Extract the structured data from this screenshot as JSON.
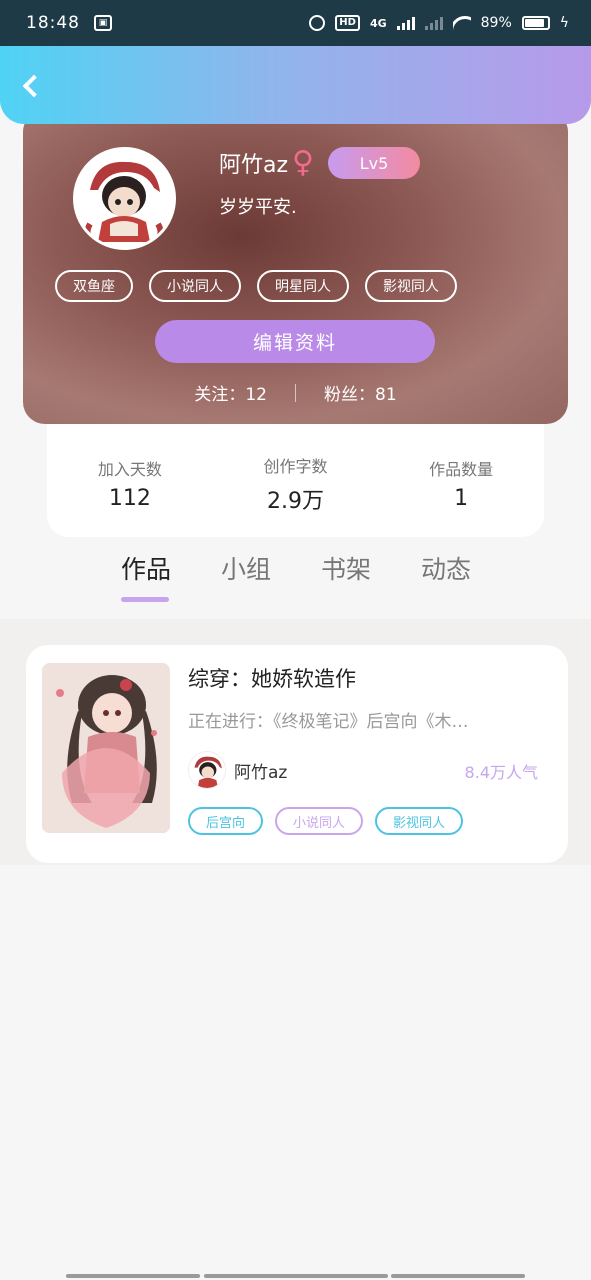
{
  "status_bar": {
    "time": "18:48",
    "hd_label": "HD",
    "network": "4G",
    "battery_text": "89%",
    "battery_level": 0.89,
    "icons": [
      "alarm-icon",
      "hd-icon",
      "signal-icon",
      "wifi-icon",
      "battery-icon",
      "charging-icon"
    ]
  },
  "header": {
    "back_icon": "back-arrow-icon",
    "gradient": [
      "#4fd3f4",
      "#b79aea"
    ]
  },
  "profile": {
    "username": "阿竹az",
    "gender_symbol": "♀",
    "level": "Lv5",
    "bio": "岁岁平安.",
    "tags": [
      "双鱼座",
      "小说同人",
      "明星同人",
      "影视同人"
    ],
    "edit_button": "编辑资料",
    "following": "关注：12",
    "followers": "粉丝：81"
  },
  "stats": [
    {
      "label": "加入天数",
      "value": "112"
    },
    {
      "label": "创作字数",
      "value": "2.9万"
    },
    {
      "label": "作品数量",
      "value": "1"
    }
  ],
  "tabs": [
    {
      "label": "作品",
      "active": true
    },
    {
      "label": "小组",
      "active": false
    },
    {
      "label": "书架",
      "active": false
    },
    {
      "label": "动态",
      "active": false
    }
  ],
  "works": [
    {
      "title": "综穿：她娇软造作",
      "description": "正在进行：《终极笔记》后宫向《木…",
      "author": "阿竹az",
      "popularity": "8.4万人气",
      "tags": [
        {
          "label": "后宫向",
          "color": "#4cc3e0"
        },
        {
          "label": "小说同人",
          "color": "#c9a6ec"
        },
        {
          "label": "影视同人",
          "color": "#4cc3e0"
        }
      ]
    }
  ],
  "colors": {
    "accent_purple": "#b98ae8",
    "tab_indicator": "#c6a4ef",
    "gender_pink": "#f26a8d"
  }
}
